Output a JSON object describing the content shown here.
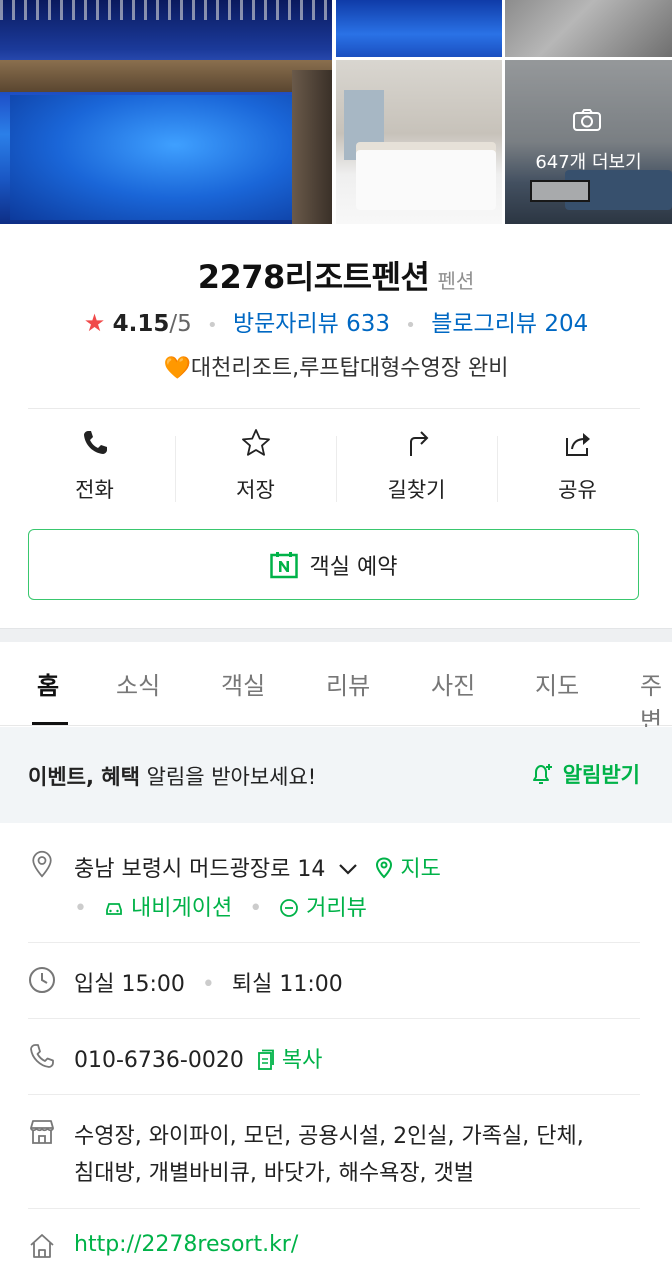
{
  "photos": {
    "more_label": "647개 더보기"
  },
  "header": {
    "title": "2278리조트펜션",
    "category": "펜션",
    "rating_score": "4.15",
    "rating_outof": "/5",
    "visitor_reviews": "방문자리뷰 633",
    "blog_reviews": "블로그리뷰 204",
    "tagline_icon": "🧡",
    "tagline": "대천리조트,루프탑대형수영장 완비"
  },
  "actions": [
    {
      "label": "전화",
      "icon": "phone-icon"
    },
    {
      "label": "저장",
      "icon": "star-icon"
    },
    {
      "label": "길찾기",
      "icon": "directions-icon"
    },
    {
      "label": "공유",
      "icon": "share-icon"
    }
  ],
  "reserve_label": "객실 예약",
  "tabs": [
    {
      "label": "홈",
      "active": true
    },
    {
      "label": "소식"
    },
    {
      "label": "객실"
    },
    {
      "label": "리뷰"
    },
    {
      "label": "사진"
    },
    {
      "label": "지도"
    },
    {
      "label": "주변"
    }
  ],
  "notice": {
    "bold": "이벤트, 혜택",
    "text": " 알림을 받아보세요!",
    "button": "알림받기"
  },
  "info": {
    "address": "충남 보령시 머드광장로 14",
    "map_link": "지도",
    "navi_link": "내비게이션",
    "street_link": "거리뷰",
    "checkin": "입실 15:00",
    "checkout": "퇴실 11:00",
    "phone": "010-6736-0020",
    "copy": "복사",
    "amenities_line1": "수영장, 와이파이, 모던, 공용시설, 2인실, 가족실, 단체,",
    "amenities_line2": "침대방, 개별바비큐, 바닷가, 해수욕장, 갯벌",
    "website": "http://2278resort.kr/"
  },
  "colors": {
    "accent_green": "#00b248",
    "review_blue": "#0068c3",
    "star_red": "#f04a4a"
  }
}
